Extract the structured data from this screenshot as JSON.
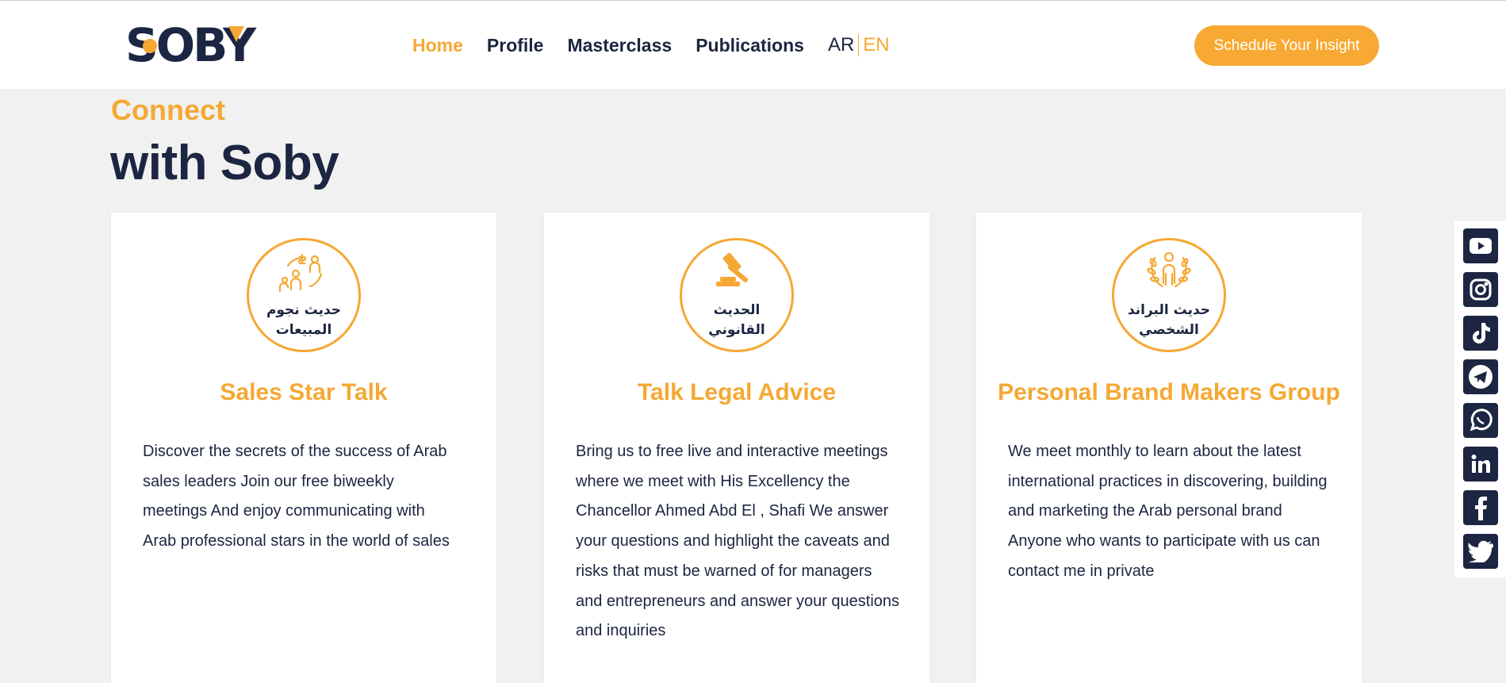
{
  "header": {
    "logo_text": "SOBY",
    "nav": [
      {
        "label": "Home",
        "active": true
      },
      {
        "label": "Profile",
        "active": false
      },
      {
        "label": "Masterclass",
        "active": false
      },
      {
        "label": "Publications",
        "active": false
      }
    ],
    "lang": {
      "ar": "AR",
      "en": "EN",
      "selected": "EN"
    },
    "cta_label": "Schedule Your Insight"
  },
  "hero": {
    "kicker": "Connect",
    "headline": "with Soby"
  },
  "cards": [
    {
      "icon": "sales-people-icon",
      "badge_lines": [
        "حديث نجوم",
        "المبيعات"
      ],
      "title": "Sales Star Talk",
      "desc_lines": [
        "Discover the secrets of the success of Arab",
        "sales leaders  Join our free biweekly",
        "meetings And enjoy communicating with",
        "Arab professional stars in the world of sales"
      ]
    },
    {
      "icon": "gavel-icon",
      "badge_lines": [
        "الحديث",
        "القانوني"
      ],
      "title": "Talk Legal Advice",
      "desc_lines": [
        "Bring us to free live and interactive meetings",
        "where we meet with His Excellency the",
        "Chancellor Ahmed Abd El , Shafi We answer",
        "your questions and highlight the caveats and",
        "risks that must be warned of for managers",
        "and entrepreneurs and answer your questions",
        "and inquiries"
      ]
    },
    {
      "icon": "laurel-person-icon",
      "badge_lines": [
        "حديث البراند",
        "الشخصي"
      ],
      "title": "Personal Brand Makers Group",
      "desc_lines": [
        "We meet monthly to learn about the latest",
        "international practices in discovering, building",
        "and marketing the Arab personal brand",
        "Anyone who wants to participate with us can",
        "contact me in private"
      ]
    }
  ],
  "social": [
    "youtube-icon",
    "instagram-icon",
    "tiktok-icon",
    "telegram-icon",
    "whatsapp-icon",
    "linkedin-icon",
    "facebook-icon",
    "twitter-icon"
  ],
  "colors": {
    "accent": "#f5a833",
    "navy": "#1c2541",
    "bg": "#f1f1f1"
  }
}
